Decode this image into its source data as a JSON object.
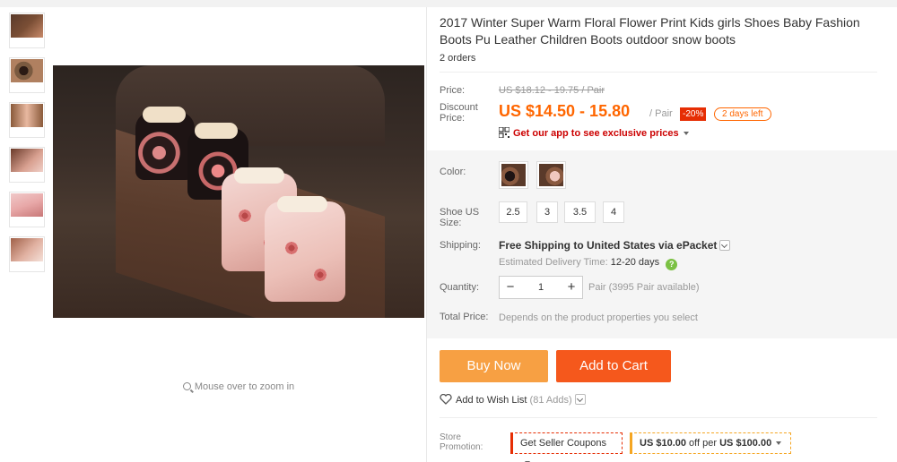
{
  "product": {
    "title": "2017 Winter Super Warm Floral Flower Print Kids girls Shoes Baby Fashion Boots Pu Leather Children Boots outdoor snow boots",
    "orders": "2 orders"
  },
  "gallery": {
    "thumbnails": [
      "thumbnail-1",
      "thumbnail-2",
      "thumbnail-3",
      "thumbnail-4",
      "thumbnail-5",
      "thumbnail-6"
    ],
    "zoom_hint": "Mouse over to zoom in"
  },
  "price": {
    "price_label": "Price:",
    "original": "US $18.12 - 19.75 / Pair",
    "discount_label_1": "Discount",
    "discount_label_2": "Price:",
    "discount": "US $14.50 - 15.80",
    "unit": "/ Pair",
    "percent_off": "-20%",
    "days_left": "2 days left",
    "app_link": "Get our app to see exclusive prices"
  },
  "options": {
    "color_label": "Color:",
    "size_label_1": "Shoe US",
    "size_label_2": "Size:",
    "sizes": [
      "2.5",
      "3",
      "3.5",
      "4"
    ]
  },
  "shipping": {
    "label": "Shipping:",
    "text": "Free Shipping to United States via ePacket",
    "delivery_label": "Estimated Delivery Time:",
    "delivery_value": "12-20 days",
    "help": "?"
  },
  "quantity": {
    "label": "Quantity:",
    "minus": "−",
    "value": "1",
    "plus": "+",
    "available": "Pair (3995 Pair available)"
  },
  "total": {
    "label": "Total Price:",
    "hint": "Depends on the product properties you select"
  },
  "actions": {
    "buy_now": "Buy Now",
    "add_to_cart": "Add to Cart",
    "wish_list": "Add to Wish List",
    "wish_count": "(81 Adds)"
  },
  "promotion": {
    "label_1": "Store",
    "label_2": "Promotion:",
    "seller_coupons": "Get Seller Coupons",
    "coupon_amount": "US $10.00",
    "coupon_mid": "off per",
    "coupon_min": "US $100.00"
  },
  "colors": {
    "accent": "#ff6600",
    "buy_now": "#f7a043",
    "add_to_cart": "#f5581c",
    "sale_badge": "#e62e04",
    "app_link": "#cc0000"
  }
}
